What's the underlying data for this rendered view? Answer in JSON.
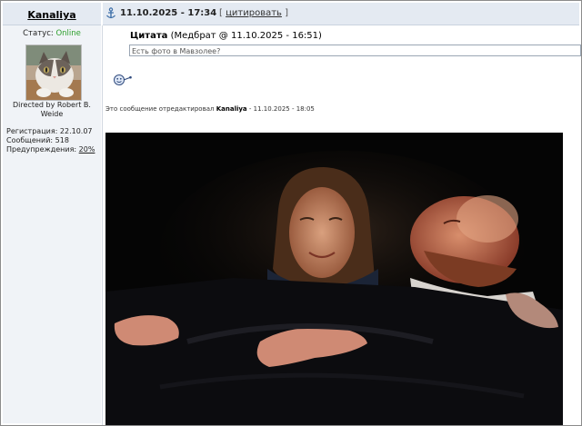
{
  "post": {
    "author": "Kanaliya",
    "date": "11.10.2025 - 17:34",
    "quote_bracket_open": "[",
    "quote_link": "цитировать",
    "quote_bracket_close": "]"
  },
  "profile": {
    "status_label": "Статус:",
    "status_value": "Online",
    "signature": "Directed by Robert B. Weide",
    "reg_label": "Регистрация: 22.10.07",
    "msgs_label": "Сообщений: 518",
    "warn_label": "Предупреждения:",
    "warn_value": "20%"
  },
  "quote": {
    "title": "Цитата",
    "meta": "(Медбрат @ 11.10.2025 - 16:51)",
    "text": "Есть фото в Мавзолее?"
  },
  "edit_note": {
    "prefix": "Это сообщение отредактировал",
    "editor": "Kanaliya",
    "suffix": "- 11.10.2025 - 18:05"
  },
  "icons": {
    "anchor": "anchor-icon",
    "smiley": "smiley-icon",
    "avatar": "cat-avatar"
  },
  "colors": {
    "header_bg": "#e4eaf2",
    "sidebar_bg": "#f0f3f7",
    "online": "#2ea02e"
  }
}
